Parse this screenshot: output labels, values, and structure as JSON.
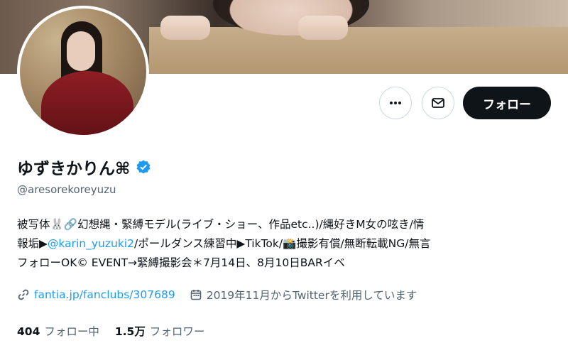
{
  "profile": {
    "display_name": "ゆずきかりん⌘",
    "handle": "@aresorekoreyuzu",
    "verified": true,
    "bio": {
      "line1": "被写体🐰🔗幻想縄・緊縛モデル(ライブ・ショー、作品etc..)/縄好きM女の呟き/情",
      "line2_before": "報垢▶",
      "line2_mention": "@karin_yuzuki2",
      "line2_after": "/ポールダンス練習中▶TikTok/📸撮影有償/無断転載NG/無言",
      "line3": "フォローOK© EVENT→緊縛撮影会＊7月14日、8月10日BARイベ"
    },
    "link": "fantia.jp/fanclubs/307689",
    "joined": "2019年11月からTwitterを利用しています",
    "following_count": "404",
    "following_label": "フォロー中",
    "followers_count": "1.5万",
    "followers_label": "フォロワー"
  },
  "actions": {
    "more_icon": "more-icon",
    "message_icon": "mail-icon",
    "follow_label": "フォロー"
  },
  "colors": {
    "accent": "#1d9bf0",
    "text": "#0f1419",
    "muted": "#536471",
    "follow_bg": "#0f1419"
  }
}
